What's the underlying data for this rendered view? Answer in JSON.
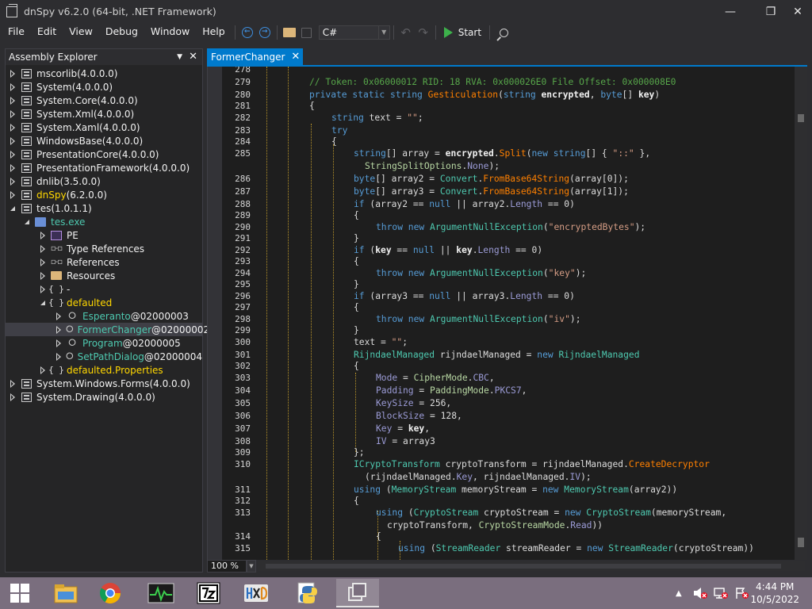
{
  "window": {
    "title": "dnSpy v6.2.0 (64-bit, .NET Framework)",
    "minimize": "—",
    "maximize": "❐",
    "close": "✕"
  },
  "menu": [
    "File",
    "Edit",
    "View",
    "Debug",
    "Window",
    "Help"
  ],
  "toolbar": {
    "back_glyph": "←",
    "forward_glyph": "→",
    "language": "C#",
    "dropdown_glyph": "▼",
    "undo_glyph": "↶",
    "redo_glyph": "↷",
    "start_label": "Start"
  },
  "explorer": {
    "title": "Assembly Explorer",
    "dropdown_glyph": "▼",
    "close_glyph": "✕",
    "items": [
      {
        "name": "mscorlib",
        "ver": " (4.0.0.0)"
      },
      {
        "name": "System",
        "ver": " (4.0.0.0)"
      },
      {
        "name": "System.Core",
        "ver": " (4.0.0.0)"
      },
      {
        "name": "System.Xml",
        "ver": " (4.0.0.0)"
      },
      {
        "name": "System.Xaml",
        "ver": " (4.0.0.0)"
      },
      {
        "name": "WindowsBase",
        "ver": " (4.0.0.0)"
      },
      {
        "name": "PresentationCore",
        "ver": " (4.0.0.0)"
      },
      {
        "name": "PresentationFramework",
        "ver": " (4.0.0.0)"
      },
      {
        "name": "dnlib",
        "ver": " (3.5.0.0)"
      },
      {
        "name": "dnSpy",
        "ver": " (6.2.0.0)"
      },
      {
        "name": "tes",
        "ver": " (1.0.1.1)"
      },
      {
        "name": "tes.exe",
        "ver": ""
      },
      {
        "name": "PE",
        "ver": ""
      },
      {
        "name": "Type References",
        "ver": ""
      },
      {
        "name": "References",
        "ver": ""
      },
      {
        "name": "Resources",
        "ver": ""
      },
      {
        "name": "-",
        "ver": ""
      },
      {
        "name": "defaulted",
        "ver": ""
      },
      {
        "name": "Esperanto",
        "ver": " @02000003"
      },
      {
        "name": "FormerChanger",
        "ver": " @02000002"
      },
      {
        "name": "Program",
        "ver": " @02000005"
      },
      {
        "name": "SetPathDialog",
        "ver": " @02000004"
      },
      {
        "name": "defaulted.Properties",
        "ver": ""
      },
      {
        "name": "System.Windows.Forms",
        "ver": " (4.0.0.0)"
      },
      {
        "name": "System.Drawing",
        "ver": " (4.0.0.0)"
      }
    ]
  },
  "editor": {
    "tab_label": "FormerChanger",
    "tab_close": "✕",
    "zoom": "100 %",
    "line_numbers": [
      "278",
      "279",
      "280",
      "281",
      "282",
      "283",
      "284",
      "285",
      "286",
      "287",
      "288",
      "289",
      "290",
      "291",
      "292",
      "293",
      "294",
      "295",
      "296",
      "297",
      "298",
      "299",
      "300",
      "301",
      "302",
      "303",
      "304",
      "305",
      "306",
      "307",
      "308",
      "309",
      "310",
      "311",
      "312",
      "313",
      "314",
      "315"
    ]
  },
  "taskbar": {
    "time": "4:44 PM",
    "date": "10/5/2022",
    "apps": [
      "file-explorer",
      "chrome",
      "process-monitor",
      "7-zip",
      "hxd",
      "python",
      "dnspy"
    ]
  }
}
